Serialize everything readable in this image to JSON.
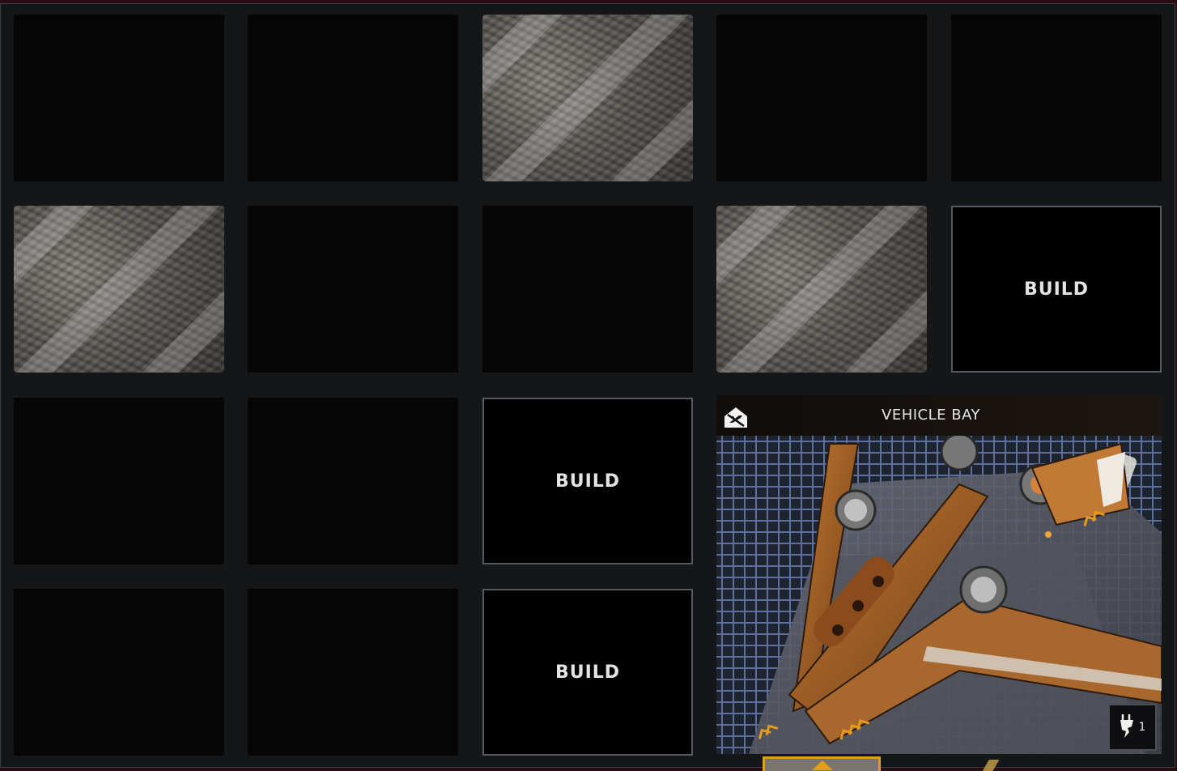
{
  "grid": {
    "rows": [
      [
        "empty",
        "empty",
        "rock",
        "empty",
        "empty"
      ],
      [
        "rock",
        "empty",
        "empty",
        "rock",
        "build"
      ],
      [
        "empty",
        "empty",
        "build",
        "vehicle-bay",
        "vehicle-bay"
      ],
      [
        "empty",
        "empty",
        "build",
        "vehicle-bay",
        "vehicle-bay"
      ]
    ],
    "build_label": "BUILD"
  },
  "vehicle_bay": {
    "title": "VEHICLE BAY",
    "type_icon": "no-aircraft-icon",
    "power_icon": "power-plug-icon",
    "power_count": "1"
  },
  "colors": {
    "panel_bg": "#151617",
    "slot_bg": "#060606",
    "build_border": "#56595f",
    "accent_orange": "#e59b1c",
    "ship_orange": "#b5651f"
  }
}
